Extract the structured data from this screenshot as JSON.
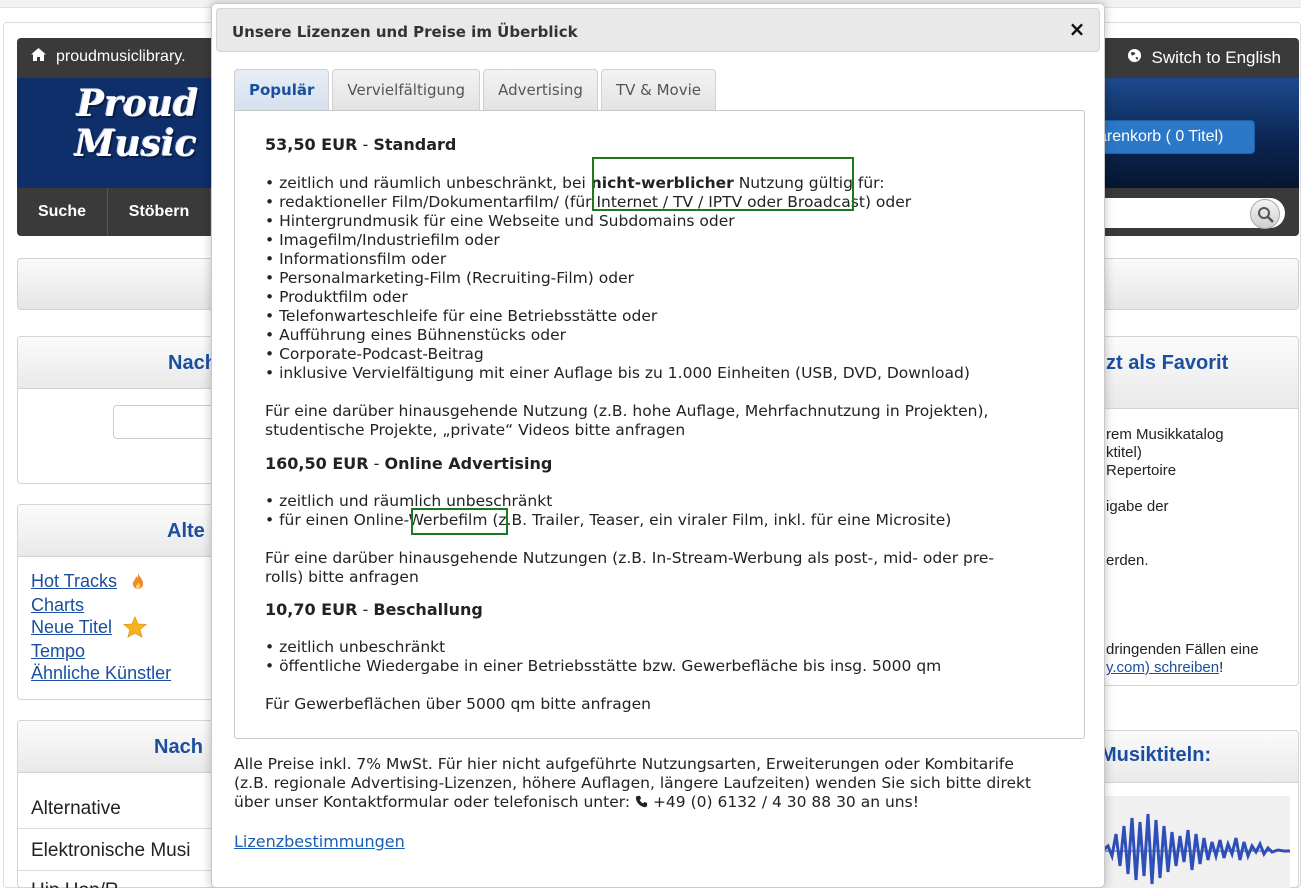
{
  "background": {
    "site_name": "proudmusiclibrary.",
    "switch_language": "Switch to English",
    "logo_line1": "Proud",
    "logo_line2": "Music",
    "cart_label": "arenkorb ( 0 Titel)",
    "nav": [
      "Suche",
      "Stöbern"
    ],
    "left_panels": {
      "panel1_title": "Nach",
      "panel2_title": "Alte",
      "panel3_title": "Nach"
    },
    "links": [
      "Hot Tracks",
      "Charts",
      "Neue Titel",
      "Tempo",
      "Ähnliche Künstler"
    ],
    "genres": [
      "Alternative",
      "Elektronische Musi",
      "Hip Hop/R"
    ],
    "right_panel": {
      "title": "zt als Favorit",
      "lines": [
        "rem Musikkatalog",
        "ktitel)",
        "Repertoire",
        "igabe der",
        "erden.",
        " dringenden Fällen eine"
      ],
      "link_text": "y.com) schreiben",
      "link_suffix": "!",
      "title2": "Musiktiteln:"
    }
  },
  "modal": {
    "title": "Unsere Lizenzen und Preise im Überblick",
    "close_label": "×",
    "tabs": [
      "Populär",
      "Vervielfältigung",
      "Advertising",
      "TV & Movie"
    ],
    "sections": [
      {
        "price": "53,50 EUR",
        "name": "Standard",
        "bullet1_pre": "• zeitlich und räumlich unbeschränkt, bei ",
        "bullet1_bold": "nicht-werblicher",
        "bullet1_post": " Nutzung gültig für:",
        "bullets": [
          "• redaktioneller Film/Dokumentarfilm/ (für Internet / TV / IPTV oder Broadcast) oder",
          "• Hintergrundmusik für eine Webseite und Subdomains oder",
          "• Imagefilm/Industriefilm oder",
          "• Informationsfilm oder",
          "• Personalmarketing-Film (Recruiting-Film) oder",
          "• Produktfilm oder",
          "• Telefonwarteschleife für eine Betriebsstätte oder",
          "• Aufführung eines Bühnenstücks oder",
          "• Corporate-Podcast-Beitrag",
          "• inklusive Vervielfältigung mit einer Auflage bis zu 1.000 Einheiten (USB, DVD, Download)"
        ],
        "note_line1": "Für eine darüber hinausgehende Nutzung (z.B. hohe Auflage, Mehrfachnutzung in Projekten),",
        "note_line2": "studentische Projekte, „private“ Videos bitte anfragen"
      },
      {
        "price": "160,50 EUR",
        "name": "Online Advertising",
        "bullets": [
          "• zeitlich und räumlich unbeschränkt",
          "• für einen Online-Werbefilm (z.B. Trailer, Teaser, ein viraler Film, inkl. für eine Microsite)"
        ],
        "note_line1": "Für eine darüber hinausgehende Nutzungen (z.B. In-Stream-Werbung als post-, mid- oder pre-",
        "note_line2": "rolls) bitte anfragen"
      },
      {
        "price": "10,70 EUR",
        "name": "Beschallung",
        "bullets": [
          "• zeitlich unbeschränkt",
          "• öffentliche Wiedergabe in einer Betriebsstätte bzw. Gewerbefläche bis insg. 5000 qm"
        ],
        "note_line1": "Für Gewerbeflächen über 5000 qm bitte anfragen"
      }
    ],
    "separator": " - ",
    "footer_line1": "Alle Preise inkl. 7% MwSt. Für hier nicht aufgeführte Nutzungsarten, Erweiterungen oder Kombitarife",
    "footer_line2": "(z.B. regionale Advertising-Lizenzen, höhere Auflagen, längere Laufzeiten) wenden Sie sich bitte direkt",
    "footer_line3_pre": "über unser Kontaktformular oder telefonisch unter: ",
    "footer_phone": "+49 (0) 6132 / 4 30 88 30",
    "footer_line3_post": " an uns!",
    "license_link": "Lizenzbestimmungen"
  }
}
